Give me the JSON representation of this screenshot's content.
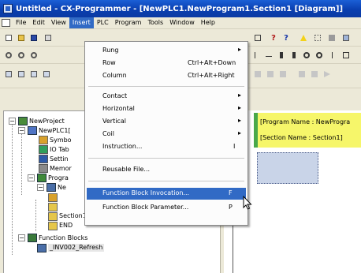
{
  "window": {
    "title": "Untitled - CX-Programmer - [NewPLC1.NewProgram1.Section1 [Diagram]]"
  },
  "menubar": {
    "items": [
      {
        "label": "File"
      },
      {
        "label": "Edit"
      },
      {
        "label": "View"
      },
      {
        "label": "Insert",
        "active": true
      },
      {
        "label": "PLC"
      },
      {
        "label": "Program"
      },
      {
        "label": "Tools"
      },
      {
        "label": "Window"
      },
      {
        "label": "Help"
      }
    ]
  },
  "insert_menu": {
    "items": [
      {
        "label": "Rung",
        "shortcut": "",
        "submenu": true,
        "highlighted": false
      },
      {
        "label": "Row",
        "shortcut": "Ctrl+Alt+Down",
        "submenu": false,
        "highlighted": false
      },
      {
        "label": "Column",
        "shortcut": "Ctrl+Alt+Right",
        "submenu": false,
        "highlighted": false
      },
      {
        "separator": true
      },
      {
        "label": "Contact",
        "shortcut": "",
        "submenu": true,
        "highlighted": false
      },
      {
        "label": "Horizontal",
        "shortcut": "",
        "submenu": true,
        "highlighted": false
      },
      {
        "label": "Vertical",
        "shortcut": "",
        "submenu": true,
        "highlighted": false
      },
      {
        "label": "Coil",
        "shortcut": "",
        "submenu": true,
        "highlighted": false
      },
      {
        "label": "Instruction...",
        "shortcut": "I",
        "submenu": false,
        "highlighted": false
      },
      {
        "separator": true
      },
      {
        "label": "Reusable File...",
        "shortcut": "",
        "submenu": false,
        "highlighted": false
      },
      {
        "separator": true
      },
      {
        "label": "Function Block Invocation...",
        "shortcut": "F",
        "submenu": false,
        "highlighted": true
      },
      {
        "label": "Function Block Parameter...",
        "shortcut": "P",
        "submenu": false,
        "highlighted": false
      }
    ]
  },
  "project_tree": {
    "nodes": [
      {
        "label": "NewProject",
        "icon": "project-icon"
      },
      {
        "label": "NewPLC1[",
        "icon": "plc-icon"
      },
      {
        "label": "Symbo",
        "icon": "symbols-icon"
      },
      {
        "label": "IO Tab",
        "icon": "io-table-icon"
      },
      {
        "label": "Settin",
        "icon": "settings-icon"
      },
      {
        "label": "Memor",
        "icon": "memory-icon"
      },
      {
        "label": "Progra",
        "icon": "programs-icon"
      },
      {
        "label": "Ne",
        "icon": "program-icon"
      },
      {
        "label": "",
        "icon": "symbols-icon"
      },
      {
        "label": "",
        "icon": "section-icon"
      },
      {
        "label": "Section1",
        "icon": "section-icon"
      },
      {
        "label": "END",
        "icon": "section-icon"
      },
      {
        "label": "Function Blocks",
        "icon": "function-blocks-icon"
      },
      {
        "label": "_INV002_Refresh",
        "icon": "function-block-icon"
      }
    ]
  },
  "diagram": {
    "program_name": "[Program Name : NewProgra",
    "section_name": "[Section Name : Section1]"
  },
  "colors": {
    "title_bar": "#0a3fb0",
    "menu_highlight": "#316ac5",
    "rung_comment": "#f6f66a",
    "rung_bar": "#49a84a"
  }
}
